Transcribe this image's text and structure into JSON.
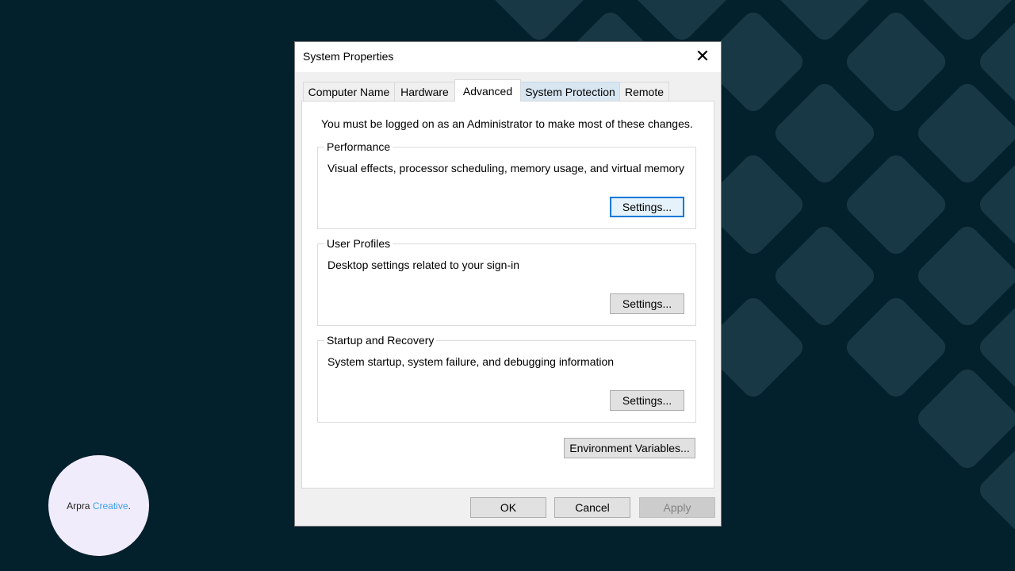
{
  "window": {
    "title": "System Properties",
    "close_glyph": "✕"
  },
  "tabs": [
    {
      "label": "Computer Name"
    },
    {
      "label": "Hardware"
    },
    {
      "label": "Advanced",
      "state": "selected"
    },
    {
      "label": "System Protection",
      "state": "hover"
    },
    {
      "label": "Remote"
    }
  ],
  "advanced": {
    "notice": "You must be logged on as an Administrator to make most of these changes.",
    "performance": {
      "legend": "Performance",
      "description": "Visual effects, processor scheduling, memory usage, and virtual memory",
      "button": "Settings..."
    },
    "user_profiles": {
      "legend": "User Profiles",
      "description": "Desktop settings related to your sign-in",
      "button": "Settings..."
    },
    "startup_recovery": {
      "legend": "Startup and Recovery",
      "description": "System startup, system failure, and debugging information",
      "button": "Settings..."
    },
    "env_button": "Environment Variables..."
  },
  "footer": {
    "ok": "OK",
    "cancel": "Cancel",
    "apply": "Apply",
    "apply_state": "disabled"
  },
  "branding": {
    "name_part1": "Arpra",
    "name_part2": "Creative",
    "name_suffix": ".",
    "accent_color": "#3aa0e8"
  },
  "colors": {
    "background": "#03202d",
    "pattern": "#183845",
    "focus_border": "#0078d7"
  }
}
